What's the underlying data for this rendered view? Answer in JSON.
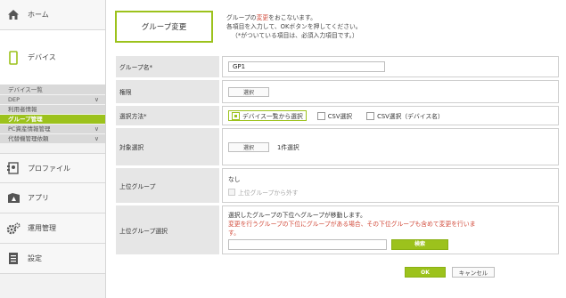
{
  "sidebar": {
    "home": "ホーム",
    "device": "デバイス",
    "device_subs": [
      {
        "label": "デバイス一覧",
        "chevron": false,
        "selected": false
      },
      {
        "label": "DEP",
        "chevron": true,
        "selected": false
      },
      {
        "label": "利用者情報",
        "chevron": false,
        "selected": false
      },
      {
        "label": "グループ管理",
        "chevron": false,
        "selected": true
      },
      {
        "label": "PC資産情報管理",
        "chevron": true,
        "selected": false
      },
      {
        "label": "代替機管理依頼",
        "chevron": true,
        "selected": false
      }
    ],
    "profile": "プロファイル",
    "apps": "アプリ",
    "operations": "運用管理",
    "settings": "設定"
  },
  "header": {
    "tab_label": "グループ変更",
    "intro_pre": "グループの",
    "intro_red": "変更",
    "intro_post": "をおこないます。",
    "intro_line2": "各項目を入力して、OKボタンを押してください。",
    "intro_line3": "（*がついている項目は、必須入力項目です。）"
  },
  "form": {
    "group_name_label": "グループ名*",
    "group_name_value": "GP1",
    "permission_label": "権限",
    "select_button": "選択",
    "method_label": "選択方法*",
    "method_options": [
      "デバイス一覧から選択",
      "CSV選択",
      "CSV選択（デバイス名）"
    ],
    "method_selected": "デバイス一覧から選択",
    "target_label": "対象選択",
    "target_button": "選択",
    "target_count": "1件選択",
    "parent_label": "上位グループ",
    "parent_value": "なし",
    "parent_remove": "上位グループから外す",
    "parent_select_label": "上位グループ選択",
    "parent_select_note": "選択したグループの下位へグループが移動します。",
    "parent_select_warn_1": "変更を行うグループの下位にグループがある場合、その下位グループも含めて変更を行いま",
    "parent_select_warn_2": "す。",
    "search_button": "検索"
  },
  "actions": {
    "ok": "OK",
    "cancel": "キャンセル"
  },
  "colors": {
    "accent": "#9cc21c",
    "warning": "#d24b3b"
  }
}
